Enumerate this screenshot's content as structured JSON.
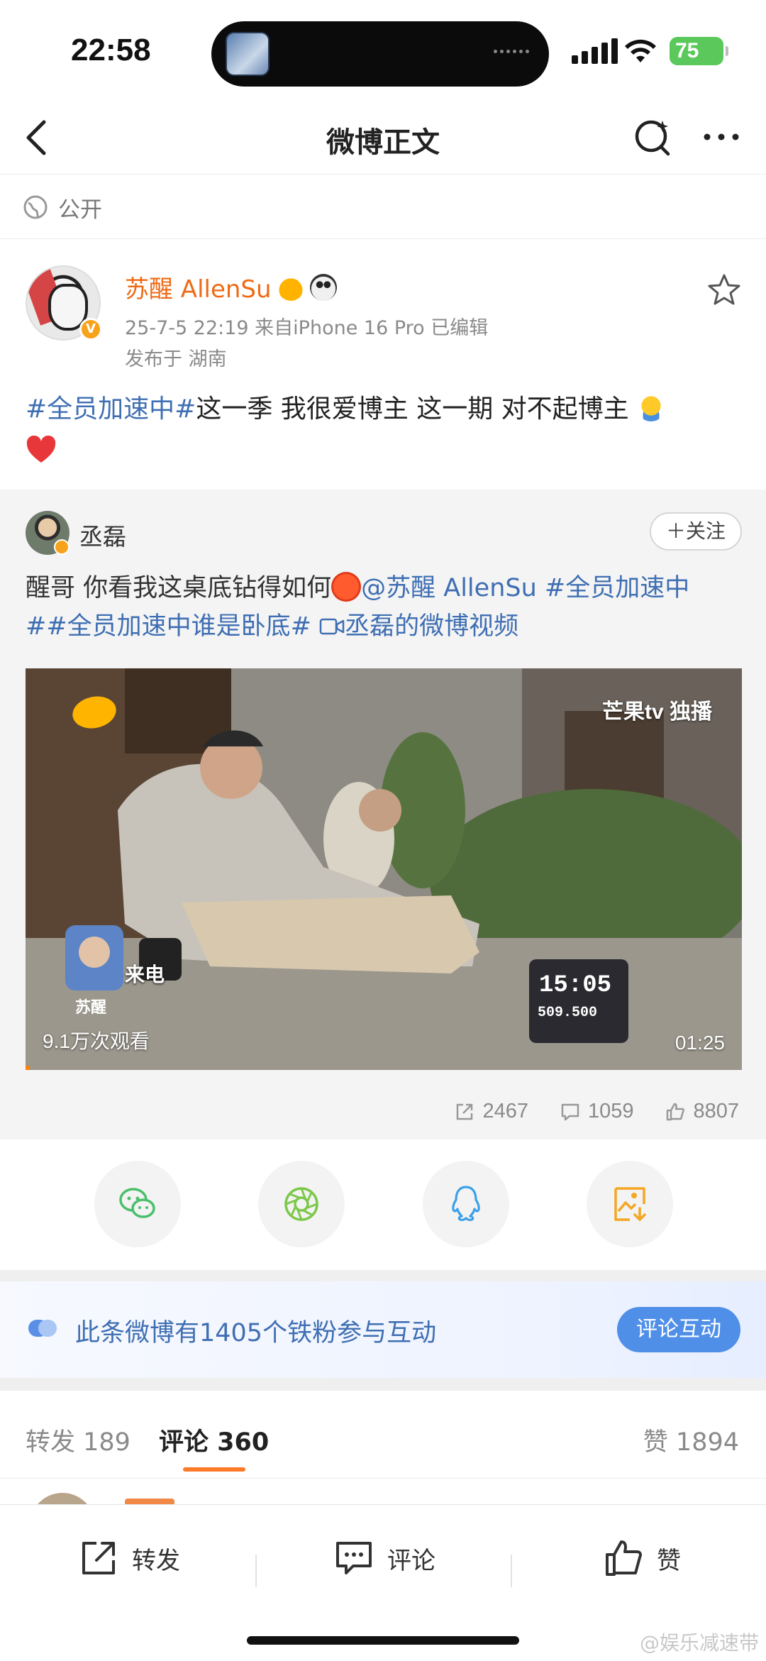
{
  "status_bar": {
    "time": "22:58",
    "battery": "75"
  },
  "nav": {
    "title": "微博正文"
  },
  "visibility": {
    "label": "公开"
  },
  "post": {
    "author": "苏醒 AllenSu",
    "meta": "25-7-5 22:19  来自iPhone 16 Pro  已编辑",
    "location": "发布于 湖南",
    "topic": "#全员加速中#",
    "text": "这一季 我很爱博主 这一期 对不起博主"
  },
  "repost": {
    "author": "丞磊",
    "follow_label": "＋关注",
    "text_line1": "醒哥 你看我这桌底钻得如何",
    "mention": "@苏醒 AllenSu",
    "topic1": "#全员加速中",
    "topic2": "##全员加速中谁是卧底#",
    "video_link": "丞磊的微博视频",
    "video": {
      "views": "9.1万次观看",
      "duration": "01:25",
      "channel_badge": "芒果tv 独播",
      "caption_name": "苏醒",
      "caption_call": "来电",
      "timer": "15:05",
      "score": "509.500"
    },
    "stats": {
      "reposts": "2467",
      "comments": "1059",
      "likes": "8807"
    }
  },
  "share_targets": [
    "wechat-icon",
    "moments-icon",
    "qq-icon",
    "save-image-icon"
  ],
  "fans_banner": {
    "text": "此条微博有1405个铁粉参与互动",
    "button": "评论互动"
  },
  "tabs": {
    "repost": "转发 189",
    "comment": "评论 360",
    "like": "赞 1894"
  },
  "bottom_bar": {
    "repost": "转发",
    "comment": "评论",
    "like": "赞"
  },
  "watermark": "@娱乐减速带",
  "colors": {
    "accent": "#ee6a16",
    "link": "#3f6fb3",
    "tab_underline": "#ff7a28",
    "fans_button": "#4f8fe8"
  }
}
